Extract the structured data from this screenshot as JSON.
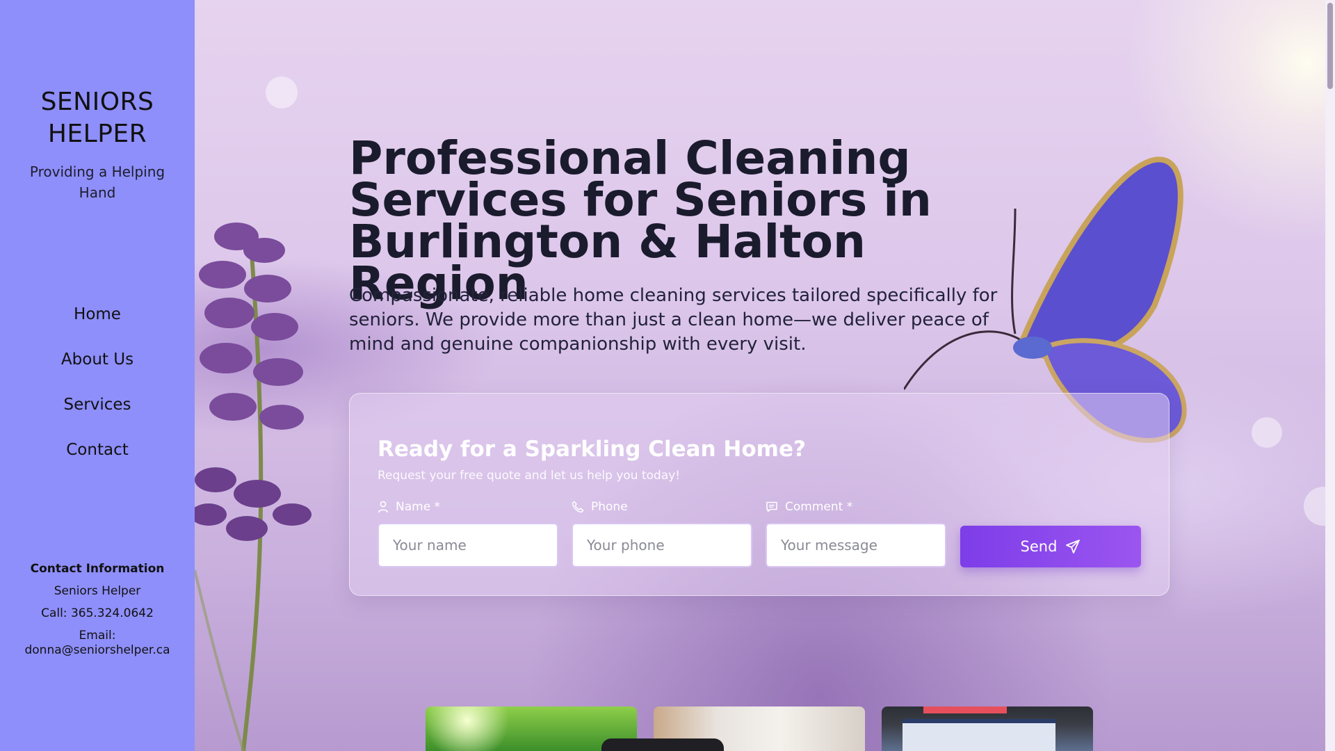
{
  "sidebar": {
    "brand": "SENIORS HELPER",
    "tagline": "Providing a Helping Hand",
    "nav": [
      {
        "label": "Home"
      },
      {
        "label": "About Us"
      },
      {
        "label": "Services"
      },
      {
        "label": "Contact"
      }
    ],
    "contact": {
      "heading": "Contact Information",
      "company": "Seniors Helper",
      "phone": "Call: 365.324.0642",
      "email": "Email: donna@seniorshelper.ca"
    }
  },
  "hero": {
    "title": "Professional Cleaning Services for Seniors in Burlington & Halton Region",
    "text": "Compassionate, reliable home cleaning services tailored specifically for seniors. We provide more than just a clean home—we deliver peace of mind and genuine companionship with every visit."
  },
  "quote_form": {
    "title": "Ready for a Sparkling Clean Home?",
    "subtitle": "Request your free quote and let us help you today!",
    "fields": [
      {
        "label": "Name *",
        "placeholder": "Your name",
        "icon": "user-icon"
      },
      {
        "label": "Phone",
        "placeholder": "Your phone",
        "icon": "phone-icon"
      },
      {
        "label": "Comment *",
        "placeholder": "Your message",
        "icon": "comment-icon"
      }
    ],
    "send_label": "Send"
  },
  "colors": {
    "sidebar_bg": "#8e8ffb",
    "accent": "#8a4af0"
  }
}
